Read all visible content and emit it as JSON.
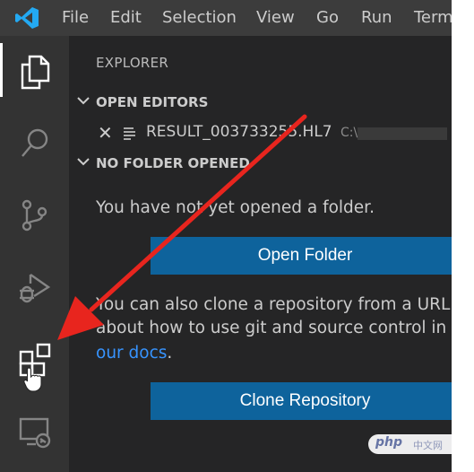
{
  "menubar": {
    "items": [
      "File",
      "Edit",
      "Selection",
      "View",
      "Go",
      "Run",
      "Term"
    ]
  },
  "activity_bar": {
    "items": [
      "explorer",
      "search",
      "source-control",
      "run-and-debug",
      "extensions",
      "remote-explorer"
    ],
    "active": "explorer"
  },
  "explorer": {
    "title": "EXPLORER",
    "open_editors": {
      "label": "OPEN EDITORS",
      "file_name": "RESULT_003733255.HL7",
      "file_path": "C:\\"
    },
    "no_folder": {
      "label": "NO FOLDER OPENED",
      "message": "You have not yet opened a folder.",
      "open_folder_label": "Open Folder",
      "clone_line1": "You can also clone a repository from a URL. T",
      "clone_line2": "about how to use git and source control in V",
      "docs_link": "our docs",
      "docs_suffix": ".",
      "clone_repo_label": "Clone Repository"
    }
  },
  "annotation": {
    "arrow_color": "#e8251e"
  },
  "watermark": {
    "text": "php",
    "sub": "中文网"
  },
  "colors": {
    "activity_bg": "#333333",
    "sidebar_bg": "#252526",
    "menubar_bg": "#3c3c3c",
    "button_bg": "#0e639c",
    "link": "#3794ff",
    "logo": "#23a9f2"
  }
}
